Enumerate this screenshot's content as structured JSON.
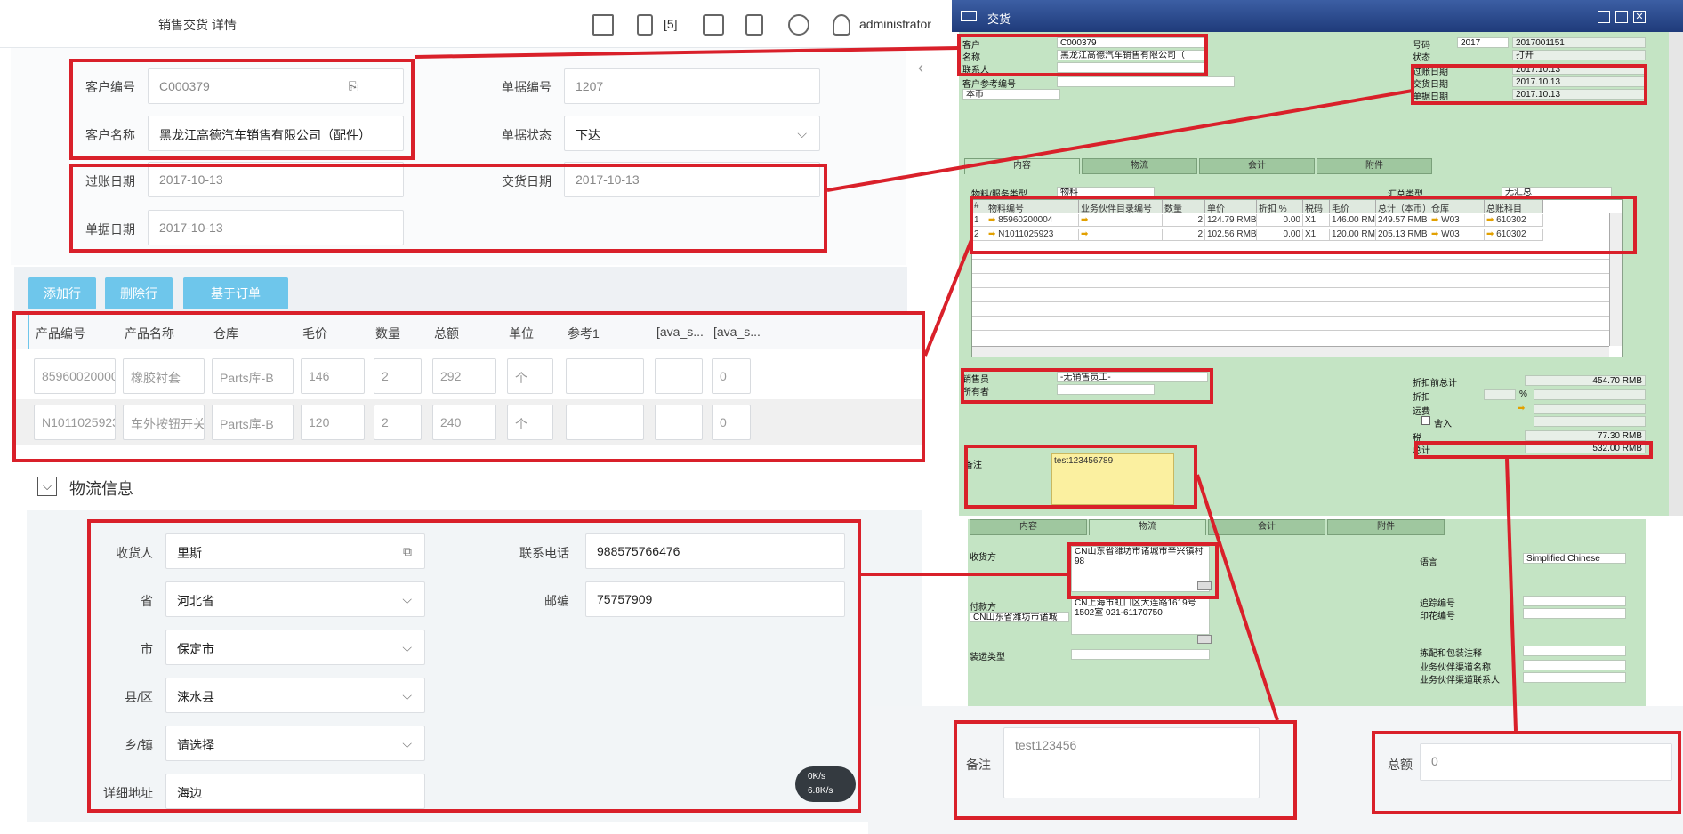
{
  "web": {
    "title": "销售交货 详情",
    "notif_count": "[5]",
    "user": "administrator",
    "form": {
      "customer_code_label": "客户编号",
      "customer_code": "C000379",
      "customer_name_label": "客户名称",
      "customer_name": "黑龙江高德汽车销售有限公司（配件）",
      "doc_no_label": "单据编号",
      "doc_no": "1207",
      "doc_status_label": "单据状态",
      "doc_status": "下达",
      "post_date_label": "过账日期",
      "post_date": "2017-10-13",
      "delivery_date_label": "交货日期",
      "delivery_date": "2017-10-13",
      "doc_date_label": "单据日期",
      "doc_date": "2017-10-13"
    },
    "buttons": {
      "add_row": "添加行",
      "delete_row": "删除行",
      "based_on_order": "基于订单"
    },
    "grid": {
      "headers": [
        "产品编号",
        "产品名称",
        "仓库",
        "毛价",
        "数量",
        "总额",
        "单位",
        "参考1",
        "[ava_s...",
        "[ava_s..."
      ],
      "rows": [
        [
          "85960020000",
          "橡胶衬套",
          "Parts库-B",
          "146",
          "2",
          "292",
          "个",
          "",
          "",
          "0"
        ],
        [
          "N1011025923",
          "车外按钮开关",
          "Parts库-B",
          "120",
          "2",
          "240",
          "个",
          "",
          "",
          "0"
        ]
      ]
    },
    "logistics": {
      "section_title": "物流信息",
      "consignee_label": "收货人",
      "consignee": "里斯",
      "phone_label": "联系电话",
      "phone": "988575766476",
      "province_label": "省",
      "province": "河北省",
      "zip_label": "邮编",
      "zip": "75757909",
      "city_label": "市",
      "city": "保定市",
      "county_label": "县/区",
      "county": "涞水县",
      "town_label": "乡/镇",
      "town": "请选择",
      "address_label": "详细地址",
      "address": "海边"
    },
    "netspeed": {
      "up": "0K/s",
      "down": "6.8K/s"
    },
    "remark_label": "备注",
    "remark": "test123456",
    "total_label": "总额",
    "total": "0"
  },
  "sap": {
    "title": "交货",
    "left": {
      "customer_label": "客户",
      "customer": "C000379",
      "name_label": "名称",
      "name": "黑龙江高德汽车销售有限公司（",
      "contact_label": "联系人",
      "custref_label": "客户参考编号",
      "currency": "本币"
    },
    "right": {
      "no_label": "号码",
      "no_series": "2017",
      "no": "2017001151",
      "status_label": "状态",
      "status": "打开",
      "post_label": "过账日期",
      "post": "2017.10.13",
      "deliv_label": "交货日期",
      "deliv": "2017.10.13",
      "docdate_label": "单据日期",
      "docdate": "2017.10.13"
    },
    "tabs": [
      "内容",
      "物流",
      "会计",
      "附件"
    ],
    "item_type_label": "物料/服务类型",
    "item_type": "物料",
    "summary_type_label": "汇总类型",
    "summary_type": "无汇总",
    "grid_headers": [
      "#",
      "物料编号",
      "业务伙伴目录编号",
      "数量",
      "单价",
      "折扣 %",
      "税码",
      "毛价",
      "总计（本币）",
      "仓库",
      "总账科目"
    ],
    "grid_rows": [
      [
        "1",
        "85960200004",
        "",
        "2",
        "124.79 RMB",
        "0.00",
        "X1",
        "146.00 RMB",
        "249.57 RMB",
        "W03",
        "610302"
      ],
      [
        "2",
        "N1011025923",
        "",
        "2",
        "102.56 RMB",
        "0.00",
        "X1",
        "120.00 RMB",
        "205.13 RMB",
        "W03",
        "610302"
      ]
    ],
    "sales_emp_label": "销售员",
    "sales_emp": "-无销售员工-",
    "owner_label": "所有者",
    "remark_label": "备注",
    "remark": "test123456789",
    "totals": {
      "before_disc_label": "折扣前总计",
      "before_disc": "454.70 RMB",
      "disc_label": "折扣",
      "pct": "%",
      "freight_label": "运费",
      "round_label": "舍入",
      "tax_label": "税",
      "tax": "77.30 RMB",
      "total_label": "总计",
      "total": "532.00 RMB"
    },
    "lower": {
      "shipto_label": "收货方",
      "shipto": "CN山东省潍坊市诸城市辛兴镇村98",
      "billto_label": "付款方",
      "billto": "CN上海市虹口区大连路1619号1502室 021-61170750",
      "billto_select": "CN山东省潍坊市诸城市",
      "ship_type_label": "装运类型",
      "lang_label": "语言",
      "lang": "Simplified Chinese",
      "tracking_label": "追踪编号",
      "stamp_label": "印花编号",
      "pick_label": "拣配和包装注释",
      "bp_channel_label": "业务伙伴渠道名称",
      "bp_contact_label": "业务伙伴渠道联系人"
    }
  }
}
